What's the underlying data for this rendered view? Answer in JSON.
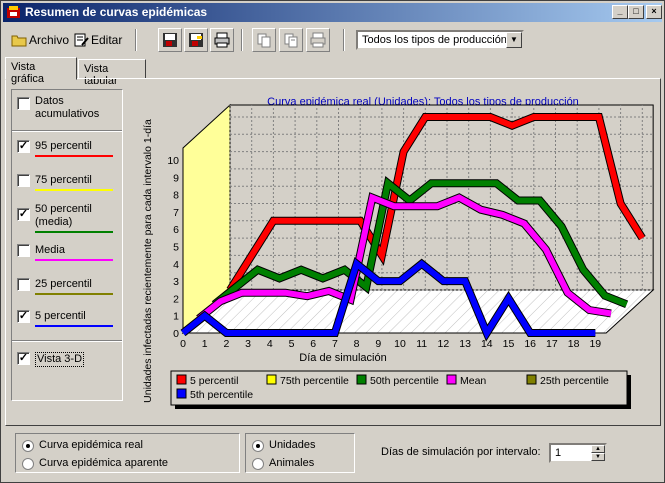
{
  "window": {
    "title": "Resumen de curvas epidémicas"
  },
  "toolbar": {
    "archivo": "Archivo",
    "editar": "Editar",
    "combo_value": "Todos los tipos de producción"
  },
  "tabs": [
    "Vista gráfica",
    "Vista tabular"
  ],
  "options": [
    {
      "label": "Datos acumulativos",
      "checked": false,
      "line_color": ""
    },
    {
      "label": "95 percentil",
      "checked": true,
      "line_color": "#ff0000"
    },
    {
      "label": "75 percentil",
      "checked": false,
      "line_color": "#ffff00"
    },
    {
      "label": "50 percentil (media)",
      "checked": true,
      "line_color": "#008000"
    },
    {
      "label": "Media",
      "checked": false,
      "line_color": "#ff00ff"
    },
    {
      "label": "25 percentil",
      "checked": false,
      "line_color": "#808000"
    },
    {
      "label": "5 percentil",
      "checked": true,
      "line_color": "#0000ff"
    },
    {
      "label": "Vista 3-D",
      "checked": true,
      "line_color": ""
    }
  ],
  "chart_data": {
    "type": "line",
    "title": "Curva epidémica real (Unidades): Todos los tipos de producción",
    "xlabel": "Día de simulación",
    "ylabel": "Unidades infectadas recientemente para cada intervalo 1-día",
    "x": [
      0,
      1,
      2,
      3,
      4,
      5,
      6,
      7,
      8,
      9,
      10,
      11,
      12,
      13,
      14,
      15,
      16,
      17,
      18,
      19
    ],
    "ylim": [
      0,
      10
    ],
    "yticks": [
      0,
      1,
      2,
      3,
      4,
      5,
      6,
      7,
      8,
      9,
      10
    ],
    "three_d": true,
    "series": [
      {
        "name": "5 percentil",
        "color": "#ff0000",
        "values": [
          0,
          2,
          4,
          4,
          4,
          4,
          4,
          2,
          8,
          10,
          10,
          10,
          10,
          9.5,
          10,
          10,
          10,
          10,
          5,
          3
        ]
      },
      {
        "name": "50th percentile",
        "color": "#008000",
        "values": [
          0,
          1,
          2,
          1.5,
          2,
          1.5,
          2,
          1,
          7,
          6,
          7,
          7,
          7,
          7,
          6,
          6,
          4.5,
          2,
          0.5,
          0
        ]
      },
      {
        "name": "Mean",
        "color": "#ff00ff",
        "values": [
          0,
          1,
          1.5,
          1.5,
          1.5,
          1.3,
          1.6,
          1.1,
          7,
          6.5,
          6.5,
          6.5,
          7,
          6.3,
          6,
          5.5,
          4,
          1.5,
          0.5,
          0.3
        ]
      },
      {
        "name": "5th percentile",
        "color": "#0000ff",
        "values": [
          0,
          1,
          0,
          0,
          0,
          0,
          0,
          0,
          4,
          3,
          3,
          4,
          3,
          3,
          0,
          2,
          0,
          0,
          0,
          0
        ]
      }
    ],
    "legend": [
      {
        "name": "5 percentil",
        "color": "#ff0000"
      },
      {
        "name": "75th percentile",
        "color": "#ffff00"
      },
      {
        "name": "50th percentile",
        "color": "#008000"
      },
      {
        "name": "Mean",
        "color": "#ff00ff"
      },
      {
        "name": "25th percentile",
        "color": "#808000"
      },
      {
        "name": "5th percentile",
        "color": "#0000ff"
      }
    ]
  },
  "bottom": {
    "curve_options": [
      {
        "label": "Curva epidémica real",
        "selected": true
      },
      {
        "label": "Curva epidémica aparente",
        "selected": false
      }
    ],
    "unit_options": [
      {
        "label": "Unidades",
        "selected": true
      },
      {
        "label": "Animales",
        "selected": false
      }
    ],
    "days_label": "Días de simulación por intervalo:",
    "days_value": "1"
  },
  "icons": [
    "app-icon",
    "archivo-icon",
    "editar-icon",
    "print-icon",
    "copy-icon",
    "minimize-icon",
    "maximize-icon",
    "close-icon"
  ]
}
